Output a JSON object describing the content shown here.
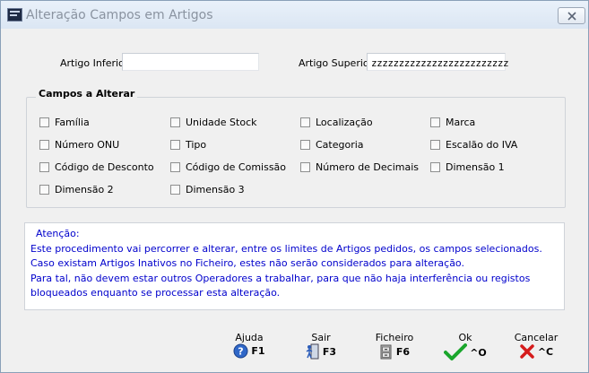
{
  "window": {
    "title": "Alteração Campos em Artigos"
  },
  "range": {
    "inferior_label": "Artigo Inferior",
    "inferior_value": "",
    "superior_label": "Artigo Superior",
    "superior_value": "zzzzzzzzzzzzzzzzzzzzzzzzz"
  },
  "fields_group": {
    "title": "Campos a Alterar",
    "checkboxes": [
      {
        "label": "Família",
        "checked": false
      },
      {
        "label": "Unidade Stock",
        "checked": false
      },
      {
        "label": "Localização",
        "checked": false
      },
      {
        "label": "Marca",
        "checked": false
      },
      {
        "label": "Número ONU",
        "checked": false
      },
      {
        "label": "Tipo",
        "checked": false
      },
      {
        "label": "Categoria",
        "checked": false
      },
      {
        "label": "Escalão do IVA",
        "checked": false
      },
      {
        "label": "Código de Desconto",
        "checked": false
      },
      {
        "label": "Código de Comissão",
        "checked": false
      },
      {
        "label": "Número de Decimais",
        "checked": false
      },
      {
        "label": "Dimensão 1",
        "checked": false
      },
      {
        "label": "Dimensão 2",
        "checked": false
      },
      {
        "label": "Dimensão 3",
        "checked": false
      }
    ]
  },
  "notice": {
    "heading": "Atenção:",
    "lines": [
      "Este procedimento vai percorrer e alterar,  entre os limites de Artigos pedidos, os campos selecionados.",
      "Caso existam Artigos Inativos no Ficheiro, estes não serão considerados para alteração.",
      "Para tal, não devem estar outros Operadores a trabalhar, para que não haja interferência ou registos",
      "bloqueados enquanto se processar esta alteração."
    ],
    "color": "#0000CC"
  },
  "toolbar": {
    "help": {
      "caption": "Ajuda",
      "key": "F1",
      "icon": "help-icon"
    },
    "exit": {
      "caption": "Sair",
      "key": "F3",
      "icon": "exit-door-icon"
    },
    "file": {
      "caption": "Ficheiro",
      "key": "F6",
      "icon": "file-cabinet-icon"
    },
    "ok": {
      "caption": "Ok",
      "key": "^O",
      "icon": "checkmark-icon"
    },
    "cancel": {
      "caption": "Cancelar",
      "key": "^C",
      "icon": "cross-icon"
    }
  }
}
